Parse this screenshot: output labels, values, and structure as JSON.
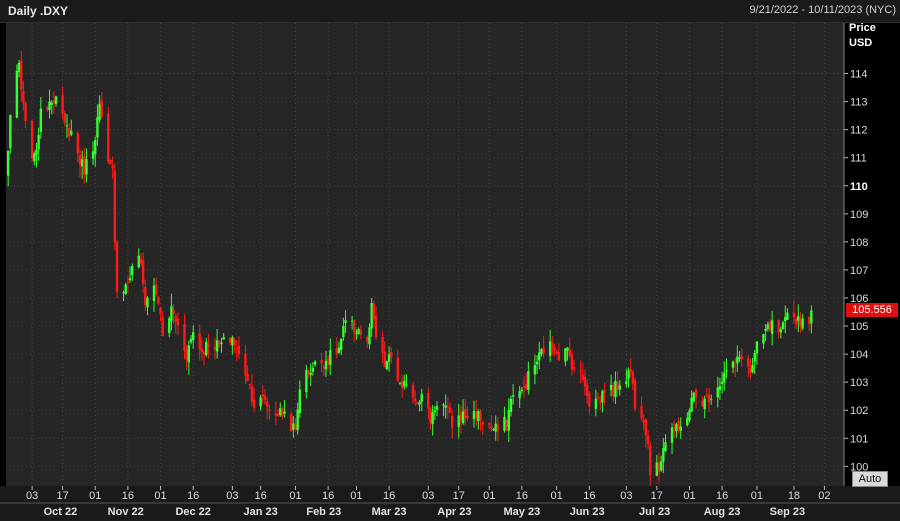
{
  "header": {
    "title": "Daily .DXY",
    "date_range": "9/21/2022 - 10/11/2023 (NYC)"
  },
  "axis": {
    "price_label": "Price",
    "currency_label": "USD"
  },
  "last_price_tag": "105.556",
  "auto_button": "Auto",
  "colors": {
    "background": "#262626",
    "up": "#35ff2e",
    "down": "#ff1a1a",
    "price_tag": "#e01010"
  },
  "chart_data": {
    "type": "candlestick",
    "title": "Daily .DXY",
    "x_range": [
      "2022-09-21",
      "2023-10-11"
    ],
    "y_range": [
      99.3,
      115.8
    ],
    "y_ticks": [
      100,
      101,
      102,
      103,
      104,
      105,
      106,
      107,
      108,
      109,
      110,
      111,
      112,
      113,
      114
    ],
    "y_tick_emphasis": 110,
    "x_day_ticks": [
      {
        "label": "03",
        "date": "2022-10-03"
      },
      {
        "label": "17",
        "date": "2022-10-17"
      },
      {
        "label": "01",
        "date": "2022-11-01"
      },
      {
        "label": "16",
        "date": "2022-11-16"
      },
      {
        "label": "01",
        "date": "2022-12-01"
      },
      {
        "label": "16",
        "date": "2022-12-16"
      },
      {
        "label": "03",
        "date": "2023-01-03"
      },
      {
        "label": "16",
        "date": "2023-01-16"
      },
      {
        "label": "01",
        "date": "2023-02-01"
      },
      {
        "label": "16",
        "date": "2023-02-16"
      },
      {
        "label": "01",
        "date": "2023-03-01"
      },
      {
        "label": "16",
        "date": "2023-03-16"
      },
      {
        "label": "03",
        "date": "2023-04-03"
      },
      {
        "label": "17",
        "date": "2023-04-17"
      },
      {
        "label": "01",
        "date": "2023-05-01"
      },
      {
        "label": "16",
        "date": "2023-05-16"
      },
      {
        "label": "01",
        "date": "2023-06-01"
      },
      {
        "label": "16",
        "date": "2023-06-16"
      },
      {
        "label": "03",
        "date": "2023-07-03"
      },
      {
        "label": "17",
        "date": "2023-07-17"
      },
      {
        "label": "01",
        "date": "2023-08-01"
      },
      {
        "label": "16",
        "date": "2023-08-16"
      },
      {
        "label": "01",
        "date": "2023-09-01"
      },
      {
        "label": "18",
        "date": "2023-09-18"
      },
      {
        "label": "02",
        "date": "2023-10-02"
      }
    ],
    "x_month_labels": [
      {
        "label": "Oct 22",
        "date": "2022-10-16"
      },
      {
        "label": "Nov 22",
        "date": "2022-11-15"
      },
      {
        "label": "Dec 22",
        "date": "2022-12-16"
      },
      {
        "label": "Jan 23",
        "date": "2023-01-16"
      },
      {
        "label": "Feb 23",
        "date": "2023-02-14"
      },
      {
        "label": "Mar 23",
        "date": "2023-03-16"
      },
      {
        "label": "Apr 23",
        "date": "2023-04-15"
      },
      {
        "label": "May 23",
        "date": "2023-05-16"
      },
      {
        "label": "Jun 23",
        "date": "2023-06-15"
      },
      {
        "label": "Jul 23",
        "date": "2023-07-16"
      },
      {
        "label": "Aug 23",
        "date": "2023-08-16"
      },
      {
        "label": "Sep 23",
        "date": "2023-09-15"
      }
    ],
    "close_path": [
      [
        "2022-09-21",
        110.2
      ],
      [
        "2022-09-23",
        112.5
      ],
      [
        "2022-09-27",
        114.3
      ],
      [
        "2022-09-28",
        113.4
      ],
      [
        "2022-09-30",
        112.1
      ],
      [
        "2022-10-04",
        110.9
      ],
      [
        "2022-10-07",
        112.5
      ],
      [
        "2022-10-12",
        113.2
      ],
      [
        "2022-10-14",
        113.1
      ],
      [
        "2022-10-18",
        112.1
      ],
      [
        "2022-10-21",
        111.9
      ],
      [
        "2022-10-25",
        110.9
      ],
      [
        "2022-10-27",
        110.6
      ],
      [
        "2022-10-31",
        111.4
      ],
      [
        "2022-11-03",
        112.8
      ],
      [
        "2022-11-07",
        110.7
      ],
      [
        "2022-11-09",
        110.5
      ],
      [
        "2022-11-10",
        108.2
      ],
      [
        "2022-11-11",
        106.3
      ],
      [
        "2022-11-15",
        106.4
      ],
      [
        "2022-11-17",
        106.8
      ],
      [
        "2022-11-21",
        107.6
      ],
      [
        "2022-11-24",
        105.9
      ],
      [
        "2022-11-28",
        106.4
      ],
      [
        "2022-11-30",
        105.9
      ],
      [
        "2022-12-02",
        104.6
      ],
      [
        "2022-12-06",
        105.6
      ],
      [
        "2022-12-09",
        105.0
      ],
      [
        "2022-12-13",
        104.0
      ],
      [
        "2022-12-16",
        104.8
      ],
      [
        "2022-12-20",
        104.1
      ],
      [
        "2022-12-23",
        104.4
      ],
      [
        "2022-12-28",
        104.3
      ],
      [
        "2023-01-03",
        104.6
      ],
      [
        "2023-01-06",
        103.9
      ],
      [
        "2023-01-10",
        103.2
      ],
      [
        "2023-01-13",
        102.2
      ],
      [
        "2023-01-18",
        102.4
      ],
      [
        "2023-01-20",
        102.0
      ],
      [
        "2023-01-24",
        101.9
      ],
      [
        "2023-01-27",
        101.9
      ],
      [
        "2023-02-01",
        101.2
      ],
      [
        "2023-02-03",
        102.9
      ],
      [
        "2023-02-07",
        103.4
      ],
      [
        "2023-02-10",
        103.6
      ],
      [
        "2023-02-15",
        103.8
      ],
      [
        "2023-02-17",
        103.9
      ],
      [
        "2023-02-21",
        104.2
      ],
      [
        "2023-02-24",
        105.1
      ],
      [
        "2023-02-28",
        104.9
      ],
      [
        "2023-03-02",
        104.9
      ],
      [
        "2023-03-06",
        104.3
      ],
      [
        "2023-03-08",
        105.6
      ],
      [
        "2023-03-10",
        104.6
      ],
      [
        "2023-03-14",
        103.6
      ],
      [
        "2023-03-17",
        103.9
      ],
      [
        "2023-03-22",
        102.6
      ],
      [
        "2023-03-24",
        103.1
      ],
      [
        "2023-03-28",
        102.4
      ],
      [
        "2023-03-31",
        102.5
      ],
      [
        "2023-04-04",
        101.7
      ],
      [
        "2023-04-07",
        102.3
      ],
      [
        "2023-04-11",
        102.1
      ],
      [
        "2023-04-14",
        101.5
      ],
      [
        "2023-04-18",
        101.8
      ],
      [
        "2023-04-21",
        101.8
      ],
      [
        "2023-04-25",
        101.9
      ],
      [
        "2023-04-28",
        101.6
      ],
      [
        "2023-05-03",
        101.3
      ],
      [
        "2023-05-05",
        101.3
      ],
      [
        "2023-05-09",
        101.6
      ],
      [
        "2023-05-12",
        102.7
      ],
      [
        "2023-05-16",
        102.6
      ],
      [
        "2023-05-19",
        103.2
      ],
      [
        "2023-05-24",
        103.9
      ],
      [
        "2023-05-26",
        104.2
      ],
      [
        "2023-05-31",
        104.3
      ],
      [
        "2023-06-02",
        104.0
      ],
      [
        "2023-06-06",
        104.1
      ],
      [
        "2023-06-09",
        103.5
      ],
      [
        "2023-06-14",
        103.0
      ],
      [
        "2023-06-16",
        102.3
      ],
      [
        "2023-06-21",
        102.4
      ],
      [
        "2023-06-23",
        102.8
      ],
      [
        "2023-06-27",
        102.7
      ],
      [
        "2023-06-30",
        103.0
      ],
      [
        "2023-07-05",
        103.4
      ],
      [
        "2023-07-07",
        102.3
      ],
      [
        "2023-07-11",
        101.8
      ],
      [
        "2023-07-13",
        100.8
      ],
      [
        "2023-07-14",
        99.9
      ],
      [
        "2023-07-18",
        99.9
      ],
      [
        "2023-07-20",
        100.8
      ],
      [
        "2023-07-24",
        101.4
      ],
      [
        "2023-07-27",
        101.2
      ],
      [
        "2023-07-31",
        101.9
      ],
      [
        "2023-08-03",
        102.5
      ],
      [
        "2023-08-08",
        102.3
      ],
      [
        "2023-08-11",
        102.6
      ],
      [
        "2023-08-15",
        103.0
      ],
      [
        "2023-08-18",
        103.4
      ],
      [
        "2023-08-22",
        103.6
      ],
      [
        "2023-08-25",
        104.0
      ],
      [
        "2023-08-29",
        103.3
      ],
      [
        "2023-09-01",
        104.2
      ],
      [
        "2023-09-05",
        104.8
      ],
      [
        "2023-09-08",
        105.0
      ],
      [
        "2023-09-12",
        104.7
      ],
      [
        "2023-09-15",
        105.3
      ],
      [
        "2023-09-19",
        105.3
      ],
      [
        "2023-09-21",
        105.2
      ],
      [
        "2023-09-25",
        105.3
      ],
      [
        "2023-09-26",
        105.556
      ]
    ],
    "last_price": 105.556
  }
}
